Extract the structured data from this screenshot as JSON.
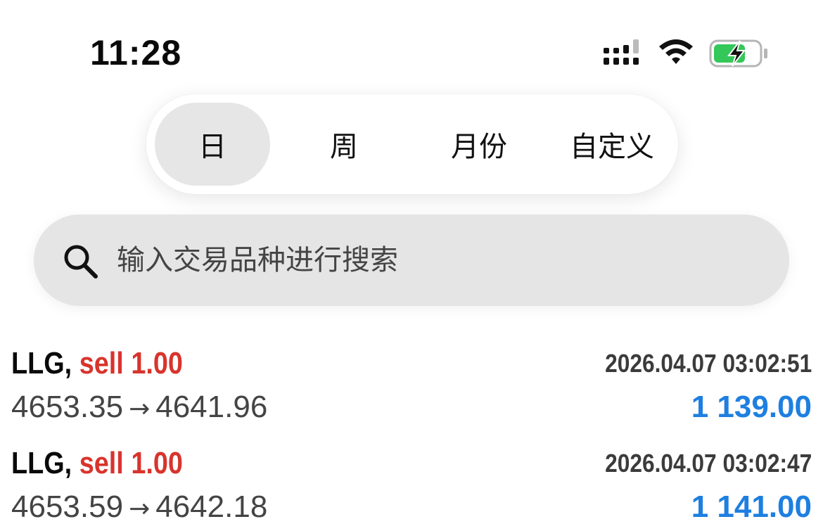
{
  "status_bar": {
    "time": "11:28"
  },
  "period_tabs": [
    {
      "label": "日",
      "active": true
    },
    {
      "label": "周",
      "active": false
    },
    {
      "label": "月份",
      "active": false
    },
    {
      "label": "自定义",
      "active": false
    }
  ],
  "search": {
    "placeholder": "输入交易品种进行搜索",
    "value": ""
  },
  "trades": [
    {
      "symbol": "LLG,",
      "side": "sell 1.00",
      "time": "2026.04.07 03:02:51",
      "open_price": "4653.35",
      "arrow": "→",
      "close_price": "4641.96",
      "profit": "1 139.00"
    },
    {
      "symbol": "LLG,",
      "side": "sell 1.00",
      "time": "2026.04.07 03:02:47",
      "open_price": "4653.59",
      "arrow": "→",
      "close_price": "4642.18",
      "profit": "1 141.00"
    }
  ],
  "colors": {
    "sell": "#d8342c",
    "profit": "#1e7fe0",
    "battery_charging": "#34c759"
  }
}
